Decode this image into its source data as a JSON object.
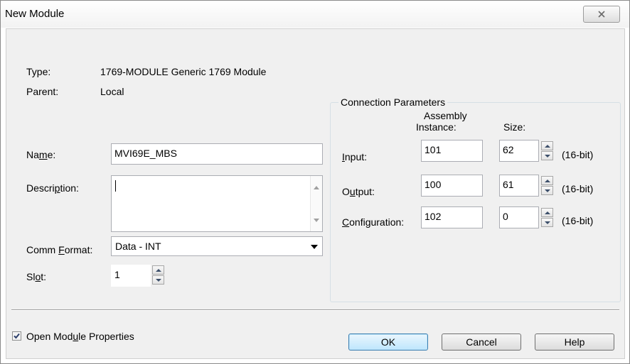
{
  "window": {
    "title": "New Module",
    "close_icon": "close-x-icon"
  },
  "info": {
    "type_label": "Type:",
    "type_value": "1769-MODULE Generic 1769 Module",
    "parent_label": "Parent:",
    "parent_value": "Local"
  },
  "form": {
    "name_label_pre": "Na",
    "name_label_u": "m",
    "name_label_post": "e:",
    "name_value": "MVI69E_MBS",
    "description_label_pre": "Descri",
    "description_label_u": "p",
    "description_label_post": "tion:",
    "description_value": "",
    "comm_format_label_pre": "Comm ",
    "comm_format_label_u": "F",
    "comm_format_label_post": "ormat:",
    "comm_format_value": "Data - INT",
    "slot_label_pre": "Sl",
    "slot_label_u": "o",
    "slot_label_post": "t:",
    "slot_value": "1"
  },
  "connection": {
    "group_title": "Connection Parameters",
    "assembly_header_line1": "Assembly",
    "assembly_header_line2": "Instance:",
    "size_header": "Size:",
    "rows": [
      {
        "label_u": "I",
        "label_post": "nput:",
        "instance": "101",
        "size": "62",
        "unit": "(16-bit)"
      },
      {
        "label_pre": "O",
        "label_u": "u",
        "label_post": "tput:",
        "instance": "100",
        "size": "61",
        "unit": "(16-bit)"
      },
      {
        "label_u": "C",
        "label_post": "onfiguration:",
        "instance": "102",
        "size": "0",
        "unit": "(16-bit)"
      }
    ]
  },
  "footer": {
    "open_props_checked": true,
    "open_props_label_pre": "Open Mod",
    "open_props_label_u": "u",
    "open_props_label_post": "le Properties",
    "ok_label": "OK",
    "cancel_label": "Cancel",
    "help_label": "Help"
  }
}
